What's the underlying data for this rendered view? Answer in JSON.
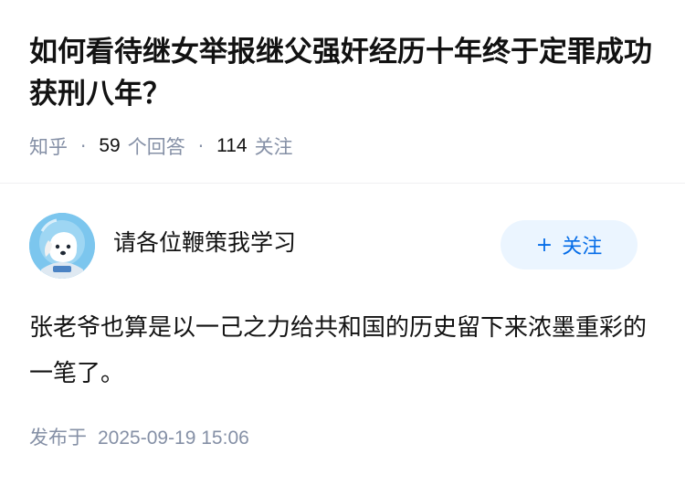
{
  "question": {
    "title": "如何看待继女举报继父强奸经历十年终于定罪成功获刑八年？",
    "source": "知乎",
    "answer_count": "59",
    "answer_label": "个回答",
    "follow_count": "114",
    "follow_label": "关注",
    "separator": "·"
  },
  "answer": {
    "author_name": "请各位鞭策我学习",
    "follow_button": "关注",
    "follow_icon": "plus-icon",
    "content": "张老爷也算是以一己之力给共和国的历史留下来浓墨重彩的一笔了。",
    "publish_label": "发布于",
    "publish_time": "2025-09-19 15:06"
  },
  "colors": {
    "accent": "#056de8",
    "button_bg": "#ebf5ff",
    "meta_text": "#8590a6",
    "main_text": "#121212",
    "avatar_bg": "#6fc0ec"
  }
}
